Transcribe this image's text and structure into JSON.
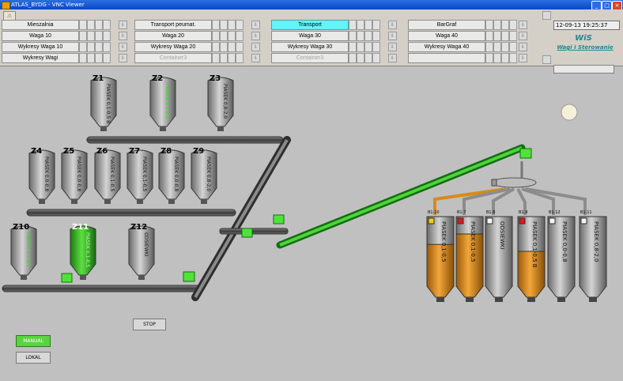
{
  "window": {
    "title": "ATLAS_BYDG - VNC Viewer"
  },
  "nav": {
    "rows": [
      [
        "Mieszalnia",
        "Transport peumat.",
        "Transport",
        "BarGraf"
      ],
      [
        "Waga 10",
        "Waga 20",
        "Waga 30",
        "Waga 40"
      ],
      [
        "Wykresy Waga 10",
        "Wykresy Waga 20",
        "Wykresy Waga 30",
        "Wykresy Waga 40"
      ],
      [
        "Wykresy Wagi",
        "Container3",
        "Container3",
        ""
      ]
    ]
  },
  "datetime": "12-09-13 19:25:37",
  "logo": {
    "name": "WiS",
    "subtitle": "Wagi i Sterowanie"
  },
  "silos": [
    {
      "id": "Z1",
      "label": "PIASEK 0,1-0,5 B",
      "active": false
    },
    {
      "id": "Z2",
      "label": "PIASEK 0,1-0,5",
      "active": false,
      "green_text": true
    },
    {
      "id": "Z3",
      "label": "PIASEK 0,8-2,0",
      "active": false
    },
    {
      "id": "Z4",
      "label": "PIASEK 0,0-0,8",
      "active": false
    },
    {
      "id": "Z5",
      "label": "PIASEK 0,0-0,8",
      "active": false
    },
    {
      "id": "Z6",
      "label": "PIASEK 0,1-0,5",
      "active": false
    },
    {
      "id": "Z7",
      "label": "PIASEK 0,1-0,5",
      "active": false
    },
    {
      "id": "Z8",
      "label": "PIASEK 0,0-0,8",
      "active": false
    },
    {
      "id": "Z9",
      "label": "PIASEK 0,8-2,0",
      "active": false
    },
    {
      "id": "Z10",
      "label": "PIASEK 0,1-0,5",
      "active": false,
      "green_text": true
    },
    {
      "id": "Z11",
      "label": "PIASEK 0,1-0,5",
      "active": true
    },
    {
      "id": "Z12",
      "label": "ODSIEWKI",
      "active": false
    }
  ],
  "bins": [
    {
      "id": "B1.10",
      "label": "PIASEK 0,1-0,5",
      "fill": 0.6,
      "led": "yellow"
    },
    {
      "id": "B1.7",
      "label": "PIASEK 0,1-0,5",
      "fill": 0.75,
      "led": "red"
    },
    {
      "id": "B1.8",
      "label": "ODSIEWKI",
      "fill": 0,
      "led": "white"
    },
    {
      "id": "B1.9",
      "label": "PIASEK 0,1-0,5 B",
      "fill": 0.5,
      "led": "red"
    },
    {
      "id": "B1.12",
      "label": "PIASEK 0,0-0,8",
      "fill": 0,
      "led": "white"
    },
    {
      "id": "B1.11",
      "label": "PIASEK 0,8-2,0",
      "fill": 0,
      "led": "white"
    }
  ],
  "controls": {
    "stop": "STOP",
    "manual": "MANUAL",
    "lokal": "LOKAL"
  },
  "colors": {
    "active_green": "#39c22a",
    "sand": "#d88a18",
    "selected_nav": "#63f3f8",
    "logo": "#1b8a8f"
  }
}
